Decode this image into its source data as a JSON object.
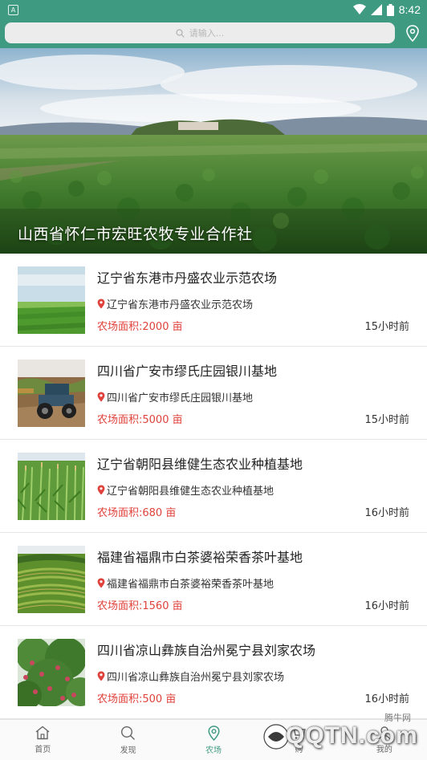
{
  "status_bar": {
    "time": "8:42"
  },
  "search": {
    "placeholder": "请输入..."
  },
  "banner": {
    "title": "山西省怀仁市宏旺农牧专业合作社"
  },
  "farms": [
    {
      "name": "辽宁省东港市丹盛农业示范农场",
      "address": "辽宁省东港市丹盛农业示范农场",
      "area": "农场面积:2000 亩",
      "time": "15小时前",
      "thumb": "rice-field"
    },
    {
      "name": "四川省广安市缪氏庄园银川基地",
      "address": "四川省广安市缪氏庄园银川基地",
      "area": "农场面积:5000 亩",
      "time": "15小时前",
      "thumb": "tractor"
    },
    {
      "name": "辽宁省朝阳县维健生态农业种植基地",
      "address": "辽宁省朝阳县维健生态农业种植基地",
      "area": "农场面积:680 亩",
      "time": "16小时前",
      "thumb": "corn-field"
    },
    {
      "name": "福建省福鼎市白茶婆裕荣香茶叶基地",
      "address": "福建省福鼎市白茶婆裕荣香茶叶基地",
      "area": "农场面积:1560 亩",
      "time": "16小时前",
      "thumb": "tea-terraces"
    },
    {
      "name": "四川省凉山彝族自治州冕宁县刘家农场",
      "address": "四川省凉山彝族自治州冕宁县刘家农场",
      "area": "农场面积:500 亩",
      "time": "16小时前",
      "thumb": "fruit-tree"
    }
  ],
  "tabs": [
    {
      "label": "首页",
      "icon": "home-icon"
    },
    {
      "label": "发现",
      "icon": "search-icon"
    },
    {
      "label": "农场",
      "icon": "location-icon",
      "active": true
    },
    {
      "label": "购",
      "icon": "cart-icon"
    },
    {
      "label": "我的",
      "icon": "user-icon"
    }
  ],
  "watermark": {
    "brand": "QQTN.com",
    "small": "腾牛网"
  },
  "colors": {
    "primary": "#3f9a82",
    "area_red": "#e0413a"
  }
}
